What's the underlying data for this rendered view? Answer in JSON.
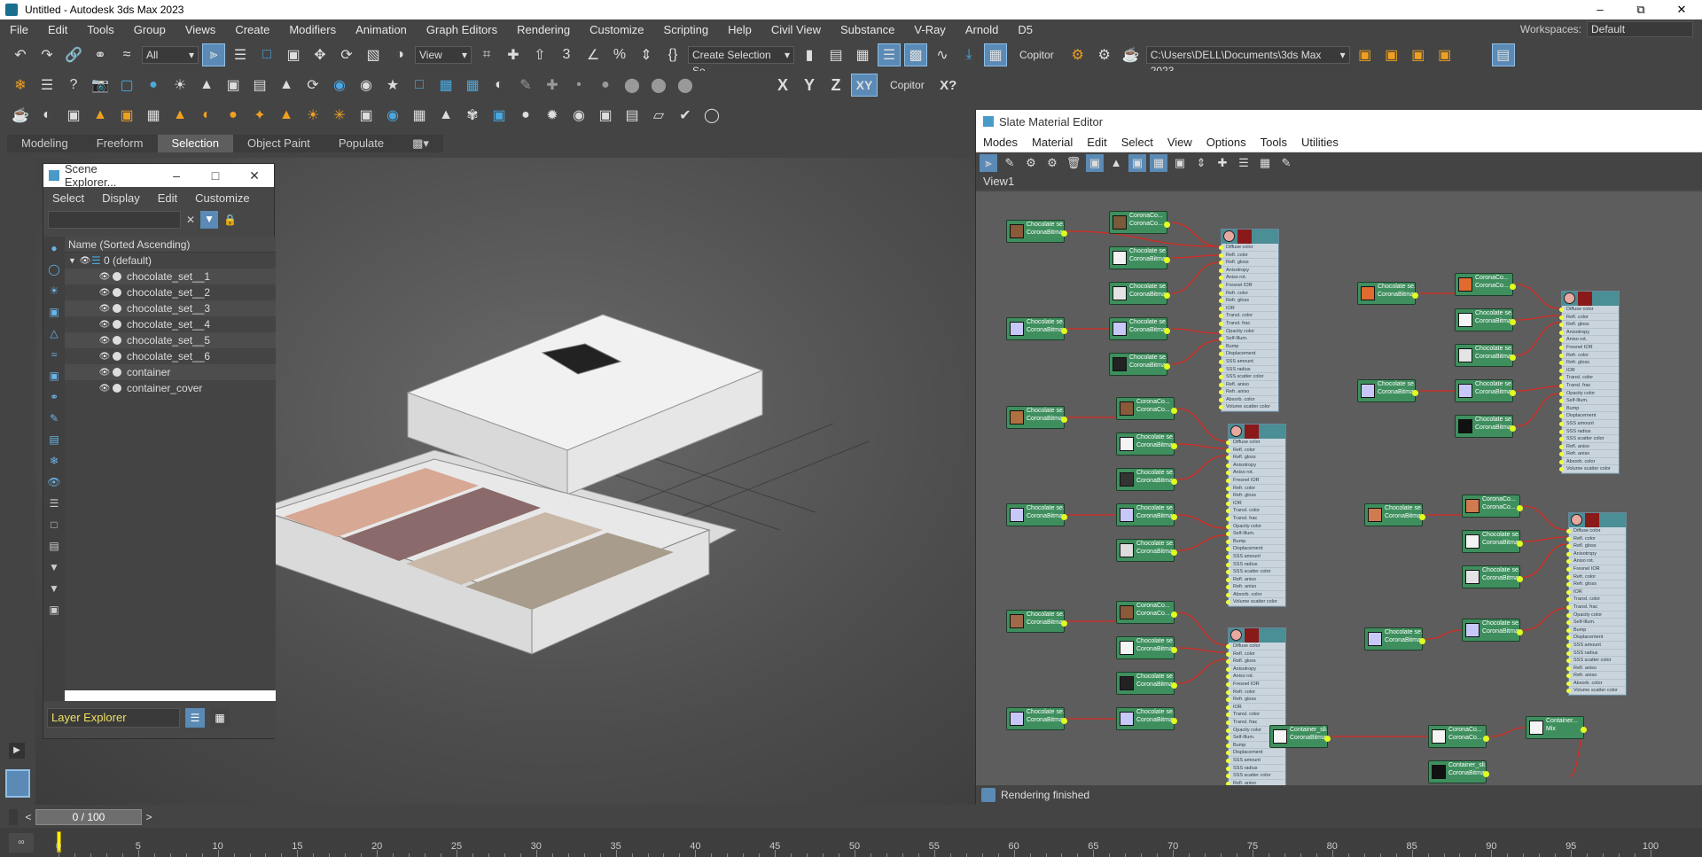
{
  "window": {
    "title": "Untitled - Autodesk 3ds Max 2023",
    "controls": [
      "–",
      "⧉",
      "✕"
    ]
  },
  "menu": [
    "File",
    "Edit",
    "Tools",
    "Group",
    "Views",
    "Create",
    "Modifiers",
    "Animation",
    "Graph Editors",
    "Rendering",
    "Customize",
    "Scripting",
    "Help",
    "Civil View",
    "Substance",
    "V-Ray",
    "Arnold",
    "D5"
  ],
  "workspaces": {
    "label": "Workspaces:",
    "value": "Default"
  },
  "toolbar": {
    "filter_value": "All",
    "view_value": "View",
    "selection_set_value": "Create Selection Se",
    "copitor_label": "Copitor",
    "path_value": "C:\\Users\\DELL\\Documents\\3ds Max 2023",
    "axis_x": "X",
    "axis_y": "Y",
    "axis_z": "Z",
    "axis_xy": "XY",
    "copitor2_label": "Copitor",
    "xq_label": "X?"
  },
  "ribbon": {
    "tabs": [
      "Modeling",
      "Freeform",
      "Selection",
      "Object Paint",
      "Populate"
    ],
    "active": "Selection"
  },
  "scene_explorer": {
    "title": "Scene Explorer...",
    "menu": [
      "Select",
      "Display",
      "Edit",
      "Customize"
    ],
    "column_header": "Name (Sorted Ascending)",
    "layer": "0 (default)",
    "items": [
      "chocolate_set__1",
      "chocolate_set__2",
      "chocolate_set__3",
      "chocolate_set__4",
      "chocolate_set__5",
      "chocolate_set__6",
      "container",
      "container_cover"
    ],
    "footer_label": "Layer Explorer"
  },
  "slate": {
    "title": "Slate Material Editor",
    "menu": [
      "Modes",
      "Material",
      "Edit",
      "Select",
      "View",
      "Options",
      "Tools",
      "Utilities"
    ],
    "view_tab": "View1",
    "status": "Rendering finished",
    "node_bitmap_title": "Chocolate se...",
    "node_bitmap_sub": "CoronaBitmap",
    "node_corona_title": "CoronaCo...",
    "node_corona_sub": "CoronaCo...",
    "node_container_title": "Container_sli...",
    "node_container_sub": "CoronaBitmap",
    "node_mix_title": "Container...",
    "node_mix_sub": "Mix",
    "mat_slots": [
      "Diffuse color",
      "Refl. color",
      "Refl. gloss",
      "Anisotropy",
      "Aniso rot.",
      "Fresnel IOR",
      "Refr. color",
      "Refr. gloss",
      "IOR",
      "Transl. color",
      "Transl. frac",
      "Opacity color",
      "Self-Illum.",
      "Bump",
      "Displacement",
      "SSS amount",
      "SSS radius",
      "SSS scatter color",
      "Refl. aniso",
      "Refr. aniso",
      "Absorb. color",
      "Volume scatter color"
    ]
  },
  "timeline": {
    "frame_display": "0 / 100"
  },
  "ruler": {
    "labels": [
      "0",
      "5",
      "10",
      "15",
      "20",
      "25",
      "30",
      "35",
      "40",
      "45",
      "50",
      "55",
      "60",
      "65",
      "70",
      "75",
      "80",
      "85",
      "90",
      "95",
      "100"
    ]
  }
}
